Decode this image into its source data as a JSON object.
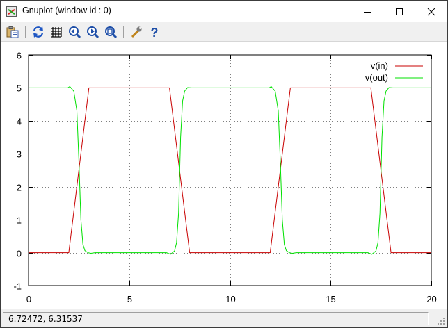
{
  "window": {
    "title": "Gnuplot (window id : 0)"
  },
  "toolbar": {
    "items": [
      {
        "name": "copy-to-clipboard-button",
        "icon": "clipboard-icon"
      },
      {
        "name": "replot-button",
        "icon": "replot-icon"
      },
      {
        "name": "grid-button",
        "icon": "grid-icon"
      },
      {
        "name": "zoom-previous-button",
        "icon": "zoom-back-icon"
      },
      {
        "name": "zoom-next-button",
        "icon": "zoom-forward-icon"
      },
      {
        "name": "autoscale-button",
        "icon": "autoscale-icon"
      },
      {
        "name": "options-button",
        "icon": "wrench-icon"
      },
      {
        "name": "help-button",
        "icon": "help-icon"
      }
    ]
  },
  "status": {
    "coords": "6.72472,  6.31537"
  },
  "colors": {
    "vin": "#c80000",
    "vout": "#00e000",
    "grid": "#808080"
  },
  "chart_data": {
    "type": "line",
    "title": "",
    "xlabel": "",
    "ylabel": "",
    "xlim": [
      0,
      20
    ],
    "ylim": [
      -1,
      6
    ],
    "xticks": [
      "0",
      "5",
      "10",
      "15",
      "20"
    ],
    "yticks": [
      "-1",
      "0",
      "1",
      "2",
      "3",
      "4",
      "5",
      "6"
    ],
    "grid": true,
    "legend_position": "top-right",
    "series": [
      {
        "name": "v(in)",
        "x": [
          0,
          2,
          3,
          7,
          8,
          12,
          13,
          17,
          18,
          20
        ],
        "y": [
          0,
          0,
          5,
          5,
          0,
          0,
          5,
          5,
          0,
          0
        ]
      },
      {
        "name": "v(out)",
        "x": [
          0,
          1.95,
          2.05,
          2.25,
          2.4,
          2.5,
          2.6,
          2.7,
          2.8,
          2.95,
          3.1,
          3.3,
          6.85,
          7.05,
          7.25,
          7.35,
          7.45,
          7.55,
          7.65,
          7.75,
          7.9,
          8.1,
          11.95,
          12.05,
          12.25,
          12.4,
          12.5,
          12.6,
          12.7,
          12.8,
          12.95,
          13.1,
          13.3,
          16.85,
          17.05,
          17.25,
          17.35,
          17.45,
          17.55,
          17.65,
          17.75,
          17.9,
          18.1,
          20
        ],
        "y": [
          5,
          5,
          5.04,
          4.9,
          4.3,
          2.8,
          1.0,
          0.25,
          0.06,
          0.0,
          -0.02,
          0,
          0,
          -0.05,
          0.05,
          0.3,
          1.2,
          3.5,
          4.6,
          4.9,
          5.01,
          5,
          5,
          5.04,
          4.9,
          4.3,
          2.8,
          1.0,
          0.25,
          0.06,
          0.0,
          -0.02,
          0,
          0,
          -0.05,
          0.05,
          0.3,
          1.2,
          3.5,
          4.6,
          4.9,
          5.01,
          5,
          5
        ]
      }
    ]
  }
}
